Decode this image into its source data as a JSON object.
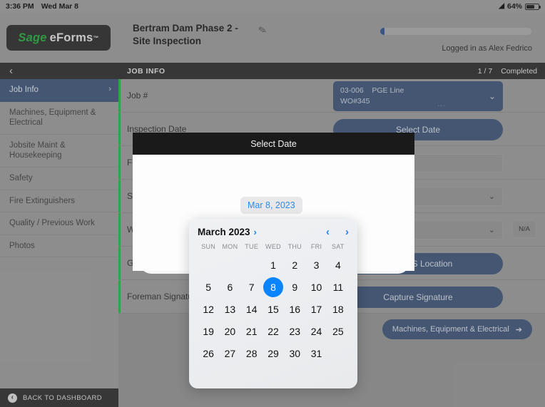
{
  "status_bar": {
    "time": "3:36 PM",
    "date": "Wed Mar 8",
    "wifi_icon": "wifi-icon",
    "battery_percent": "64%"
  },
  "sidebar": {
    "logo": {
      "sage": "Sage",
      "eforms": "eForms",
      "tm": "™"
    },
    "back_chevron": "‹",
    "items": [
      {
        "label": "Job Info",
        "active": true,
        "arrow": "›"
      },
      {
        "label": "Machines, Equipment & Electrical",
        "active": false
      },
      {
        "label": "Jobsite Maint & Housekeeping",
        "active": false
      },
      {
        "label": "Safety",
        "active": false
      },
      {
        "label": "Fire Extinguishers",
        "active": false
      },
      {
        "label": "Quality / Previous Work",
        "active": false
      },
      {
        "label": "Photos",
        "active": false
      }
    ],
    "back_to_dashboard": "BACK TO DASHBOARD",
    "back_icon": "back-arrow-icon"
  },
  "header": {
    "form_title": "Bertram Dam Phase 2 - Site Inspection",
    "edit_icon": "pencil-icon",
    "progress_percent": 3,
    "logged_in": "Logged in as Alex Fedrico"
  },
  "section_bar": {
    "title": "JOB INFO",
    "count": "1 / 7",
    "status": "Completed"
  },
  "form": {
    "rows": [
      {
        "label": "Job #",
        "control": "select-blue",
        "value_line1": "03-006",
        "value_line2": "PGE Line",
        "value_line3": "WO#345",
        "dots": "...",
        "caret": "⌄"
      },
      {
        "label": "Inspection Date",
        "control": "button-blue",
        "value": "Select Date"
      },
      {
        "label": "Foreman Name",
        "control": "text-input",
        "value": ""
      },
      {
        "label": "Safety Rating",
        "control": "dropdown",
        "value": "",
        "caret": "⌄"
      },
      {
        "label": "Work Quality",
        "control": "dropdown",
        "value": "",
        "caret": "⌄",
        "na": "N/A"
      },
      {
        "label": "GPS",
        "control": "button-blue",
        "value": "Get GPS Location"
      },
      {
        "label": "Foreman Signature",
        "control": "button-blue",
        "value": "Capture Signature"
      }
    ],
    "next_button": {
      "label": "Machines, Equipment & Electrical",
      "arrow": "➔"
    }
  },
  "modal": {
    "title": "Select Date",
    "selected_date_pill": "Mar 8, 2023"
  },
  "calendar": {
    "month_label": "March 2023",
    "month_chevron": "›",
    "prev_icon": "‹",
    "next_icon": "›",
    "weekdays": [
      "SUN",
      "MON",
      "TUE",
      "WED",
      "THU",
      "FRI",
      "SAT"
    ],
    "leading_blanks": 3,
    "days": [
      1,
      2,
      3,
      4,
      5,
      6,
      7,
      8,
      9,
      10,
      11,
      12,
      13,
      14,
      15,
      16,
      17,
      18,
      19,
      20,
      21,
      22,
      23,
      24,
      25,
      26,
      27,
      28,
      29,
      30,
      31
    ],
    "selected_day": 8
  },
  "colors": {
    "accent_blue": "#4b6183",
    "ios_blue": "#0a84ff",
    "sage_green": "#31b44a",
    "dark_bar": "#3b3b3b",
    "page_bg": "#a4a4a4"
  }
}
